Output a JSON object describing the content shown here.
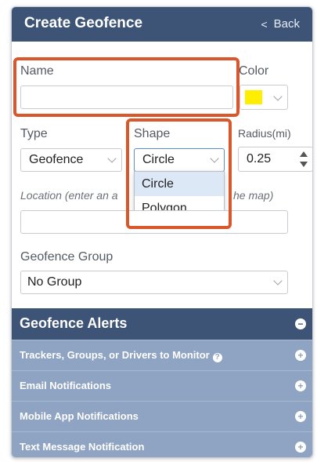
{
  "header": {
    "title": "Create Geofence",
    "back_label": "Back",
    "back_icon": "chevron-left-icon"
  },
  "form": {
    "name": {
      "label": "Name",
      "value": ""
    },
    "color": {
      "label": "Color",
      "value": "#ffee00"
    },
    "type": {
      "label": "Type",
      "value": "Geofence"
    },
    "shape": {
      "label": "Shape",
      "value": "Circle",
      "options": [
        "Circle",
        "Polygon"
      ],
      "highlighted_option": "Circle"
    },
    "radius": {
      "label": "Radius(mi)",
      "value": "0.25"
    },
    "location": {
      "label_left": "Location (enter an a",
      "label_right": "he map)",
      "value": ""
    },
    "geofence_group": {
      "label": "Geofence Group",
      "value": "No Group"
    }
  },
  "alerts": {
    "title": "Geofence Alerts",
    "toggle_icon": "minus-circle-icon",
    "rows": [
      {
        "title": "Trackers, Groups, or Drivers to Monitor",
        "has_help": true,
        "icon": "plus-circle-icon"
      },
      {
        "title": "Email Notifications",
        "has_help": false,
        "icon": "plus-circle-icon"
      },
      {
        "title": "Mobile App Notifications",
        "has_help": false,
        "icon": "plus-circle-icon"
      },
      {
        "title": "Text Message Notification",
        "has_help": false,
        "icon": "plus-circle-icon"
      }
    ]
  },
  "colors": {
    "header_bg": "#3d5477",
    "subrow_bg": "#8fa3c2",
    "highlight_border": "#d9572b",
    "dropdown_active": "#dce8f6"
  }
}
